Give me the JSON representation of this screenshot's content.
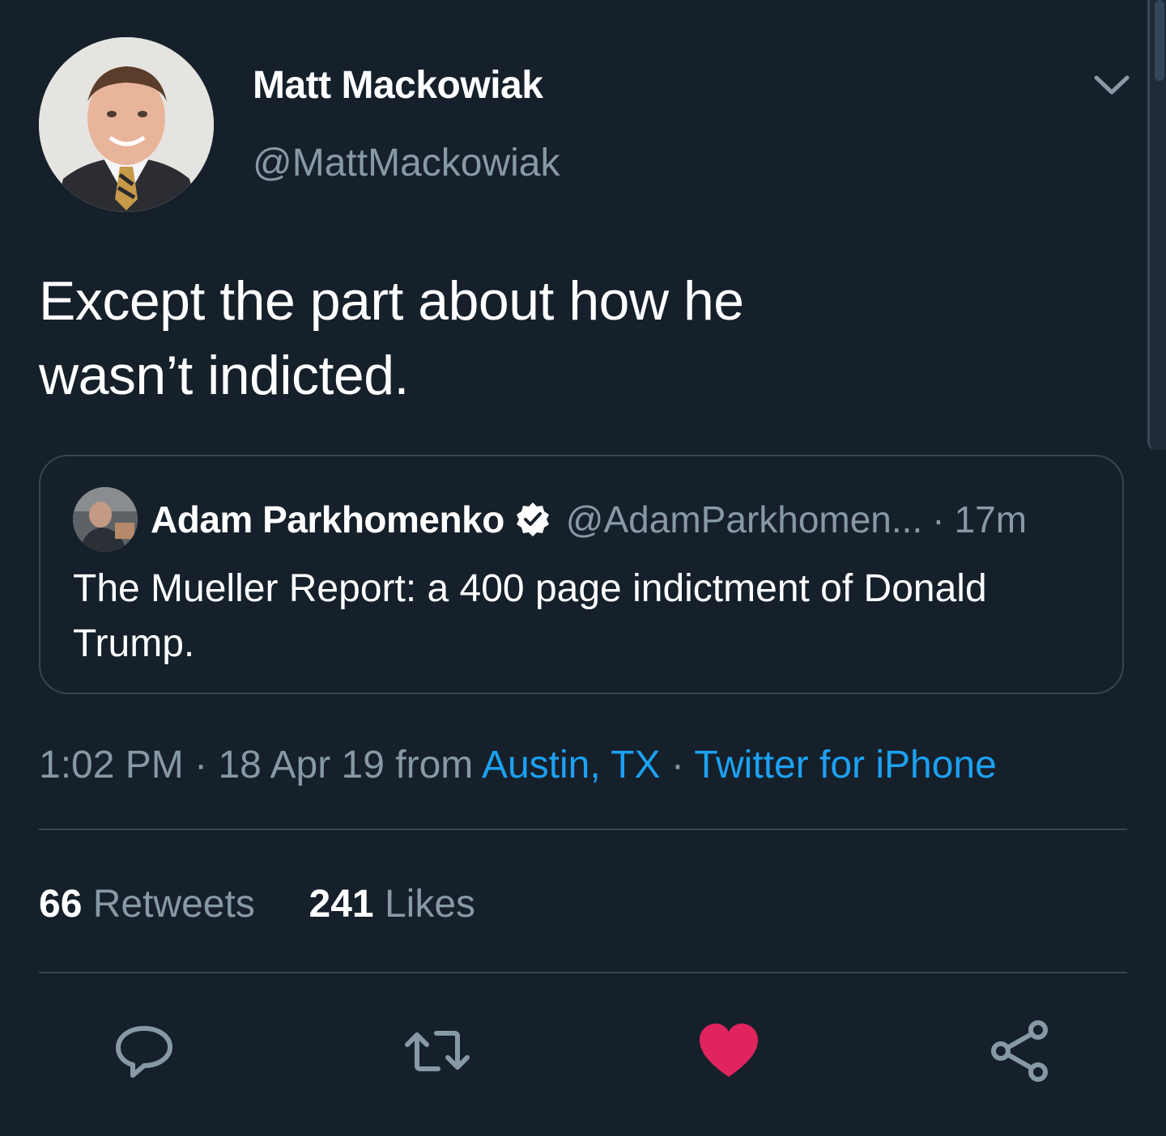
{
  "author": {
    "display_name": "Matt Mackowiak",
    "handle": "@MattMackowiak"
  },
  "tweet": {
    "text_line1": "Except the part about how he",
    "text_line2": "wasn’t indicted."
  },
  "quoted_tweet": {
    "display_name": "Adam Parkhomenko",
    "handle": "@AdamParkhomen...",
    "separator": "·",
    "time": "17m",
    "text_line1": "The Mueller Report: a 400 page indictment of Donald",
    "text_line2": "Trump."
  },
  "meta": {
    "time": "1:02 PM",
    "separator": "·",
    "date_from": "18 Apr 19 from",
    "location": "Austin, TX",
    "separator2": "·",
    "source": "Twitter for iPhone"
  },
  "stats": {
    "retweets_count": "66",
    "retweets_label": "Retweets",
    "likes_count": "241",
    "likes_label": "Likes"
  },
  "actions": {
    "reply_icon": "reply-icon",
    "retweet_icon": "retweet-icon",
    "like_icon": "heart-icon",
    "share_icon": "share-icon"
  },
  "colors": {
    "background": "#15202b",
    "link": "#1da1f2",
    "secondary_text": "#8899a6",
    "border": "#38444d",
    "like_active": "#e0245e"
  }
}
